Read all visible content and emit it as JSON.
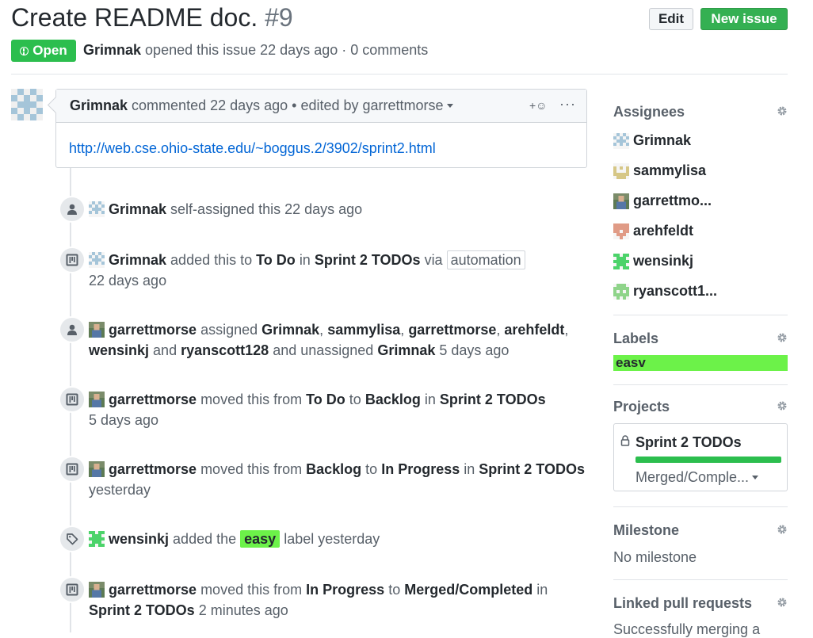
{
  "header": {
    "title": "Create README doc.",
    "number": "#9",
    "edit_label": "Edit",
    "new_issue_label": "New issue",
    "state": "Open",
    "author": "Grimnak",
    "meta": "opened this issue 22 days ago · 0 comments"
  },
  "comment": {
    "author": "Grimnak",
    "meta": "commented 22 days ago • edited by garrettmorse",
    "reaction": "+☺",
    "more": "···",
    "link": "http://web.cse.ohio-state.edu/~boggus.2/3902/sprint2.html"
  },
  "timeline": [
    {
      "actor": "Grimnak",
      "text": "self-assigned this 22 days ago"
    },
    {
      "actor": "Grimnak",
      "t1": "added this to",
      "col": "To Do",
      "t2": "in",
      "project": "Sprint 2 TODOs",
      "t3": "via",
      "tag": "automation",
      "time": "22 days ago"
    },
    {
      "actor": "garrettmorse",
      "t1": "assigned",
      "a1": "Grimnak",
      "s1": ",",
      "a2": "sammylisa",
      "s2": ",",
      "a3": "garrettmorse",
      "s3": ",",
      "a4": "arehfeldt",
      "s4": ",",
      "a5": "wensinkj",
      "t2": "and",
      "a6": "ryanscott128",
      "t3": "and unassigned",
      "a7": "Grimnak",
      "time": "5 days ago"
    },
    {
      "actor": "garrettmorse",
      "t1": "moved this from",
      "from": "To Do",
      "t2": "to",
      "to": "Backlog",
      "t3": "in",
      "project": "Sprint 2 TODOs",
      "time": "5 days ago"
    },
    {
      "actor": "garrettmorse",
      "t1": "moved this from",
      "from": "Backlog",
      "t2": "to",
      "to": "In Progress",
      "t3": "in",
      "project": "Sprint 2 TODOs",
      "time": "yesterday"
    },
    {
      "actor": "wensinkj",
      "t1": "added the",
      "label": "easy",
      "t2": "label yesterday"
    },
    {
      "actor": "garrettmorse",
      "t1": "moved this from",
      "from": "In Progress",
      "t2": "to",
      "to": "Merged/Completed",
      "t3": "in",
      "project": "Sprint 2 TODOs",
      "time": "2 minutes ago"
    }
  ],
  "sidebar": {
    "assignees_title": "Assignees",
    "assignees": [
      "Grimnak",
      "sammylisa",
      "garrettmo...",
      "arehfeldt",
      "wensinkj",
      "ryanscott1..."
    ],
    "labels_title": "Labels",
    "label": "easv",
    "projects_title": "Projects",
    "project_name": "Sprint 2 TODOs",
    "project_column": "Merged/Comple...",
    "milestone_title": "Milestone",
    "milestone_value": "No milestone",
    "linked_title": "Linked pull requests",
    "linked_value": "Successfully merging a"
  },
  "colors": {
    "open_green": "#2cbe4e",
    "label_easy": "#6cf249",
    "link_blue": "#0366d6"
  }
}
